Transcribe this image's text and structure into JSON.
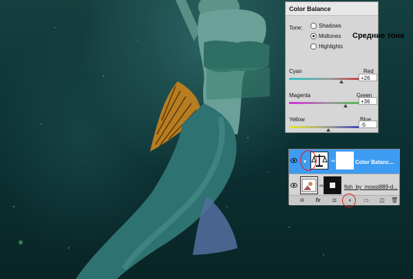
{
  "color_balance": {
    "title": "Color Balance",
    "tone_label": "Tone:",
    "tones": [
      {
        "label": "Shadows",
        "selected": false
      },
      {
        "label": "Midtones",
        "selected": true
      },
      {
        "label": "Highlights",
        "selected": false
      }
    ],
    "annotation": "Средние тона",
    "sliders": [
      {
        "left": "Cyan",
        "right": "Red",
        "value": "+26",
        "level": 0.63,
        "color_left": "#28c8c8",
        "color_right": "#d81818"
      },
      {
        "left": "Magenta",
        "right": "Green",
        "value": "+36",
        "level": 0.68,
        "color_left": "#d828d8",
        "color_right": "#28c828"
      },
      {
        "left": "Yellow",
        "right": "Blue",
        "value": "-5",
        "level": 0.475,
        "color_left": "#e8e828",
        "color_right": "#1818c8"
      }
    ]
  },
  "layers": {
    "items": [
      {
        "name": "Color Balanc...",
        "selected": true
      },
      {
        "name": "fish_by_mossi889-d...",
        "selected": false
      }
    ]
  },
  "colors": {
    "selection": "#3e9bf2",
    "highlight_circle": "#e01818"
  }
}
